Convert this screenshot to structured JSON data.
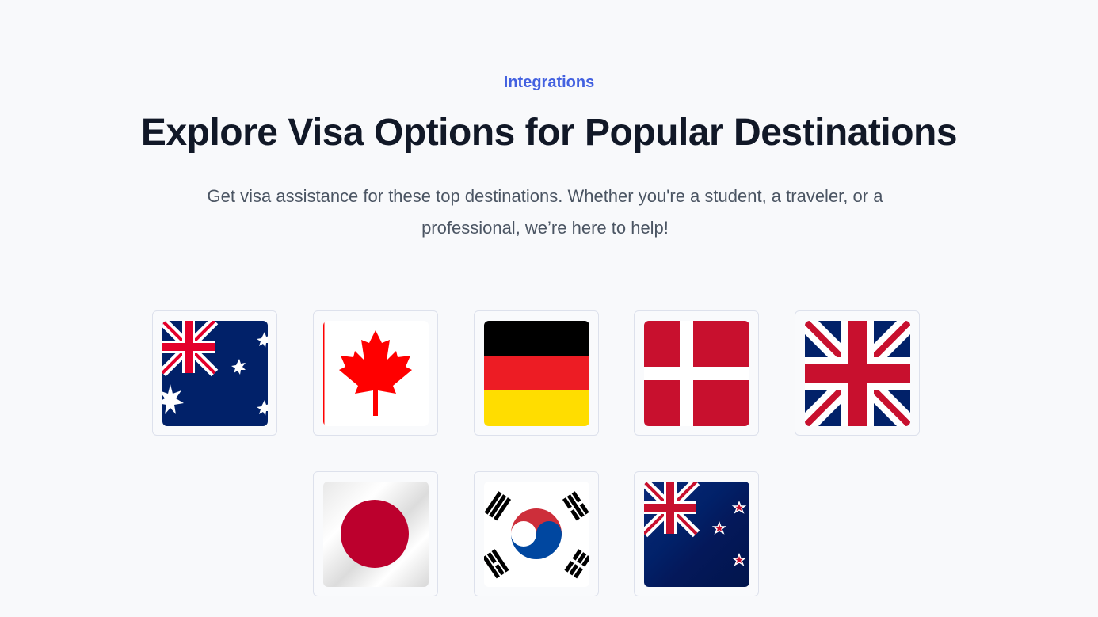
{
  "section": {
    "eyebrow": "Integrations",
    "title": "Explore Visa Options for Popular Destinations",
    "subtitle": "Get visa assistance for these top destinations. Whether you're a student, a traveler, or a professional, we’re here to help!"
  },
  "destinations": [
    {
      "icon": "australia-flag-icon"
    },
    {
      "icon": "canada-flag-icon"
    },
    {
      "icon": "germany-flag-icon"
    },
    {
      "icon": "denmark-flag-icon"
    },
    {
      "icon": "united-kingdom-flag-icon"
    },
    {
      "icon": "japan-flag-icon"
    },
    {
      "icon": "south-korea-flag-icon"
    },
    {
      "icon": "new-zealand-flag-icon"
    }
  ],
  "colors": {
    "accent": "#4361e0",
    "heading": "#111827",
    "body_text": "#4b5563",
    "tile_border": "#dde1ec",
    "background": "#f8f9fb"
  }
}
